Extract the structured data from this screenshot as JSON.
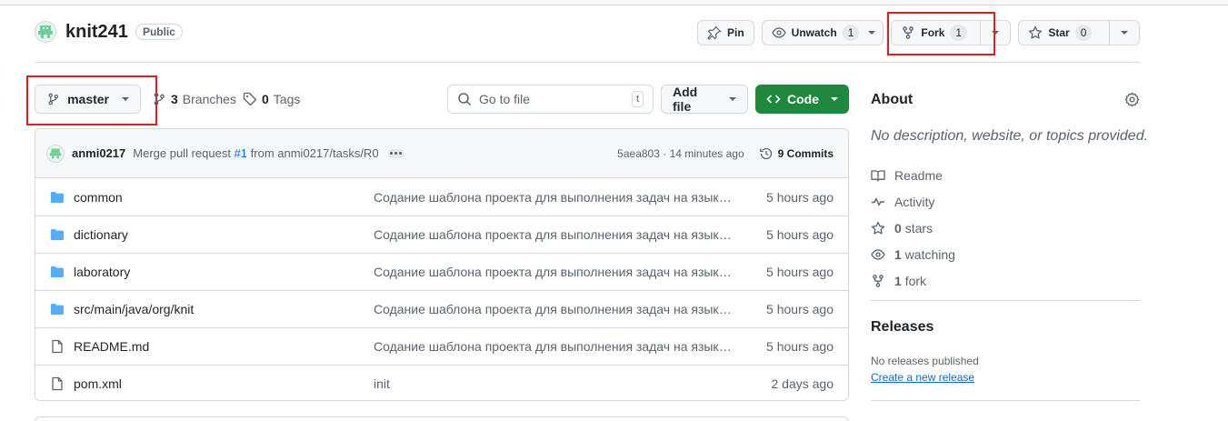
{
  "repo": {
    "name": "knit241",
    "visibility": "Public"
  },
  "header_actions": {
    "pin": "Pin",
    "unwatch": "Unwatch",
    "watch_count": "1",
    "fork": "Fork",
    "fork_count": "1",
    "star": "Star",
    "star_count": "0"
  },
  "toolbar": {
    "branch": "master",
    "branches_count": "3",
    "branches_label": "Branches",
    "tags_count": "0",
    "tags_label": "Tags",
    "goto_placeholder": "Go to file",
    "goto_shortcut": "t",
    "add_file": "Add file",
    "code": "Code"
  },
  "latest_commit": {
    "author": "anmi0217",
    "message_prefix": "Merge pull request",
    "pr": "#1",
    "message_suffix": "from anmi0217/tasks/R0",
    "sha": "5aea803",
    "separator": "·",
    "time": "14 minutes ago",
    "commits": "9 Commits"
  },
  "files": [
    {
      "type": "dir",
      "name": "common",
      "message": "Содание шаблона проекта для выполнения задач на языке Java",
      "age": "5 hours ago"
    },
    {
      "type": "dir",
      "name": "dictionary",
      "message": "Содание шаблона проекта для выполнения задач на языке Java",
      "age": "5 hours ago"
    },
    {
      "type": "dir",
      "name": "laboratory",
      "message": "Содание шаблона проекта для выполнения задач на языке Java",
      "age": "5 hours ago"
    },
    {
      "type": "dir",
      "name": "src/main/java/org/knit",
      "message": "Содание шаблона проекта для выполнения задач на языке Java",
      "age": "5 hours ago"
    },
    {
      "type": "file",
      "name": "README.md",
      "message": "Содание шаблона проекта для выполнения задач на языке Java",
      "age": "5 hours ago"
    },
    {
      "type": "file",
      "name": "pom.xml",
      "message": "init",
      "age": "2 days ago"
    }
  ],
  "about": {
    "title": "About",
    "description": "No description, website, or topics provided.",
    "readme": "Readme",
    "activity": "Activity",
    "stars_count": "0",
    "stars_label": "stars",
    "watching_count": "1",
    "watching_label": "watching",
    "fork_count": "1",
    "fork_label": "fork"
  },
  "releases": {
    "title": "Releases",
    "none": "No releases published",
    "create": "Create a new release"
  },
  "colors": {
    "highlight": "#e11d1d",
    "code_button": "#1f883d",
    "link": "#0969da",
    "folder": "#54aeff"
  }
}
